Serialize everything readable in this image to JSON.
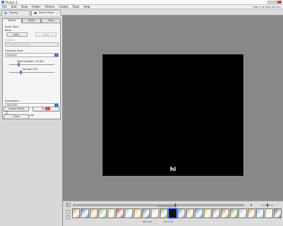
{
  "window": {
    "title": "Picasa 3"
  },
  "menu": {
    "items": [
      "File",
      "Edit",
      "View",
      "Folder",
      "Picture",
      "Create",
      "Tools",
      "Help"
    ],
    "sign_in": "Sign in to Web Albums"
  },
  "tabs": [
    {
      "label": "Library",
      "icon": "library-icon",
      "active": false
    },
    {
      "label": "Movie Maker",
      "icon": "movie-icon",
      "active": true
    }
  ],
  "panel": {
    "tabs": [
      "Movie",
      "Slide",
      "Clips"
    ],
    "active_tab": "Movie",
    "audio_track_label": "Audio Track:",
    "none_label": "None",
    "load_button": "Load...",
    "clear_button": "Clear",
    "options_label": "Options:",
    "options_value": "Fit photos to audio",
    "transition_label": "Transition Style:",
    "transition_value": "Dissolve",
    "slide_duration_label": "Slide Duration: 4.0 Sec",
    "slide_duration_value": 0.2,
    "overlap_label": "Overlap: 25%",
    "overlap_value": 0.25,
    "dimensions_label": "Dimensions:",
    "dimensions_value": "640x480",
    "show_captions": "Show Captions",
    "full_frame": "Full frame photo crop",
    "create_movie": "Create Movie",
    "youtube_prefix": "Tu",
    "youtube_badge": "You",
    "close_button": "Close"
  },
  "preview": {
    "caption": "hi"
  },
  "timeline": {
    "play_icon": "play-icon",
    "time_text": "00:01:30/00:02:59",
    "position": 0.6,
    "volume": 0.5
  },
  "filmstrip": {
    "thumbnails": [
      {
        "color": "#c9a774"
      },
      {
        "color": "#5b8dbf"
      },
      {
        "color": "#d6b37d"
      },
      {
        "color": "#8cbf6e"
      },
      {
        "color": "#e0d3a0"
      },
      {
        "color": "#c45a4a"
      },
      {
        "color": "#b7c8d6"
      },
      {
        "color": "#efc05c"
      },
      {
        "color": "#6c8db0"
      },
      {
        "color": "#d9d0c0"
      },
      {
        "color": "#9fb86a"
      },
      {
        "color": "#111111",
        "selected": true
      },
      {
        "color": "#8a9ec4"
      },
      {
        "color": "#ccb48a"
      },
      {
        "color": "#6b9bd1"
      },
      {
        "color": "#e3c989"
      },
      {
        "color": "#a8a8a8"
      },
      {
        "color": "#c28b60"
      },
      {
        "color": "#7faa5e"
      },
      {
        "color": "#bfc6d8"
      },
      {
        "color": "#d8a56a"
      },
      {
        "color": "#9cc0da"
      },
      {
        "color": "#e2dccd"
      },
      {
        "color": "#6e7e93"
      }
    ],
    "status_left": "Title Slide",
    "status_right": "(20 of 94)"
  }
}
